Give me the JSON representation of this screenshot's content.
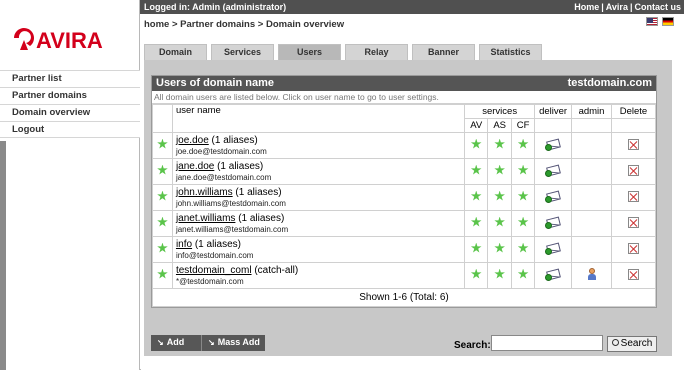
{
  "topbar": {
    "login_text": "Logged in: Admin (administrator)",
    "links": [
      "Home",
      "Avira",
      "Contact us"
    ]
  },
  "brand": {
    "name": "AVIRA",
    "color": "#d3001b"
  },
  "leftnav": [
    "Partner list",
    "Partner domains",
    "Domain overview",
    "Logout"
  ],
  "breadcrumb": "home > Partner domains > Domain overview",
  "flags": [
    "us-flag",
    "de-flag"
  ],
  "tabs": [
    "Domain",
    "Services",
    "Users",
    "Relay",
    "Banner",
    "Statistics"
  ],
  "active_tab": "Users",
  "box": {
    "title": "Users of domain name",
    "domain": "testdomain.com",
    "description": "All domain users are listed below. Click on user name to go to user settings."
  },
  "table": {
    "headers": {
      "user_name": "user name",
      "services": "services",
      "deliver": "deliver",
      "admin": "admin",
      "delete": "Delete",
      "av": "AV",
      "as": "AS",
      "cf": "CF"
    },
    "rows": [
      {
        "user": "joe.doe",
        "aliases": " (1 aliases)",
        "email": "joe.doe@testdomain.com",
        "admin": false
      },
      {
        "user": "jane.doe",
        "aliases": " (1 aliases)",
        "email": "jane.doe@testdomain.com",
        "admin": false
      },
      {
        "user": "john.williams",
        "aliases": " (1 aliases)",
        "email": "john.williams@testdomain.com",
        "admin": false
      },
      {
        "user": "janet.williams",
        "aliases": " (1 aliases)",
        "email": "janet.williams@testdomain.com",
        "admin": false
      },
      {
        "user": "info",
        "aliases": " (1 aliases)",
        "email": "info@testdomain.com",
        "admin": false
      },
      {
        "user": "testdomain_coml",
        "aliases": " (catch-all)",
        "email": "*@testdomain.com",
        "admin": true
      }
    ],
    "footer": "Shown 1-6 (Total: 6)"
  },
  "actions": {
    "add": "Add",
    "mass_add": "Mass Add"
  },
  "search": {
    "label": "Search:",
    "value": "",
    "button": "Search"
  }
}
